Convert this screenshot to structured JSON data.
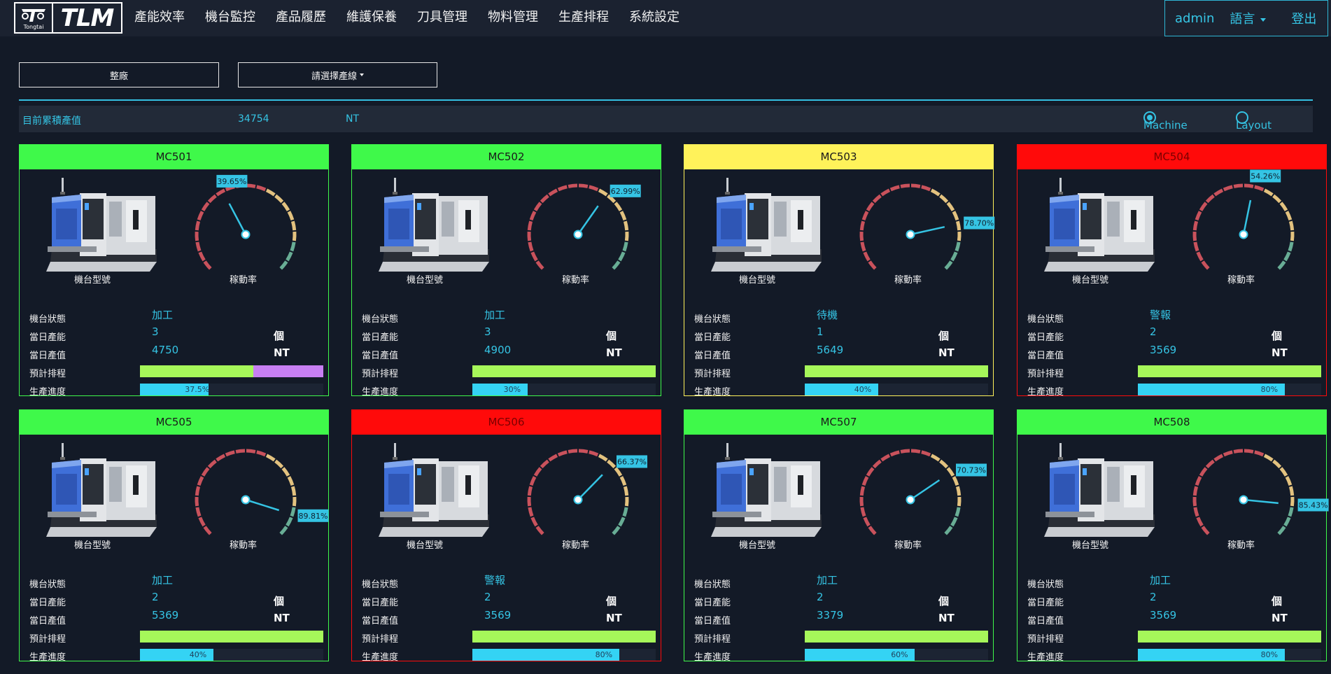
{
  "brand": {
    "logo_text": "TLM",
    "logo_sub": "Tongtai"
  },
  "nav": [
    "產能效率",
    "機台監控",
    "產品履歷",
    "維護保養",
    "刀具管理",
    "物料管理",
    "生產排程",
    "系統設定"
  ],
  "user": {
    "name": "admin",
    "language": "語言",
    "logout": "登出"
  },
  "controls": {
    "factory_btn": "整廠",
    "line_select": "請選擇產線"
  },
  "summary": {
    "label": "目前累積產值",
    "value": "34754",
    "unit": "NT",
    "view_options": [
      "Machine",
      "Layout"
    ],
    "selected_view": "Machine"
  },
  "colors": {
    "accent": "#35c4e4",
    "green": "#3ff94a",
    "yellow": "#fff25a",
    "red": "#ff0a0a",
    "plan_green": "#a6f75a",
    "plan_purple": "#c77ff2",
    "progress": "#34d3f4"
  },
  "labels": {
    "model": "機台型號",
    "utilization": "稼動率",
    "status": "機台狀態",
    "daily_output": "當日產能",
    "daily_value": "當日產值",
    "schedule": "預計排程",
    "progress": "生產進度",
    "piece_unit": "個",
    "value_unit": "NT"
  },
  "machines": [
    {
      "id": "MC501",
      "state": "green",
      "utilization": 39.65,
      "utilization_label": "39.65%",
      "status": "加工",
      "output": "3",
      "value": "4750",
      "plan_split": 0.62,
      "progress": 0.375,
      "progress_label": "37.5%"
    },
    {
      "id": "MC502",
      "state": "green",
      "utilization": 62.99,
      "utilization_label": "62.99%",
      "status": "加工",
      "output": "3",
      "value": "4900",
      "plan_split": 1,
      "progress": 0.3,
      "progress_label": "30%"
    },
    {
      "id": "MC503",
      "state": "yellow",
      "utilization": 78.7,
      "utilization_label": "78.70%",
      "status": "待機",
      "output": "1",
      "value": "5649",
      "plan_split": 1,
      "progress": 0.4,
      "progress_label": "40%"
    },
    {
      "id": "MC504",
      "state": "red",
      "utilization": 54.26,
      "utilization_label": "54.26%",
      "status": "警報",
      "output": "2",
      "value": "3569",
      "plan_split": 1,
      "progress": 0.8,
      "progress_label": "80%"
    },
    {
      "id": "MC505",
      "state": "green",
      "utilization": 89.81,
      "utilization_label": "89.81%",
      "status": "加工",
      "output": "2",
      "value": "5369",
      "plan_split": 1,
      "progress": 0.4,
      "progress_label": "40%"
    },
    {
      "id": "MC506",
      "state": "red",
      "utilization": 66.37,
      "utilization_label": "66.37%",
      "status": "警報",
      "output": "2",
      "value": "3569",
      "plan_split": 1,
      "progress": 0.8,
      "progress_label": "80%"
    },
    {
      "id": "MC507",
      "state": "green",
      "utilization": 70.73,
      "utilization_label": "70.73%",
      "status": "加工",
      "output": "2",
      "value": "3379",
      "plan_split": 1,
      "progress": 0.6,
      "progress_label": "60%"
    },
    {
      "id": "MC508",
      "state": "green",
      "utilization": 85.43,
      "utilization_label": "85.43%",
      "status": "加工",
      "output": "2",
      "value": "3569",
      "plan_split": 1,
      "progress": 0.8,
      "progress_label": "80%"
    }
  ]
}
